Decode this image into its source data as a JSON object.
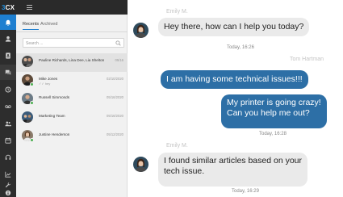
{
  "app": {
    "logo_number": "3",
    "logo_text": "CX"
  },
  "colors": {
    "accent": "#1e7fd0",
    "outgoing_bubble": "#2d6fa6",
    "incoming_bubble": "#eaeaea",
    "rail_bg": "#2d2d2d",
    "online": "#4caf50"
  },
  "rail": {
    "items": [
      {
        "icon": "bell-icon",
        "active": true
      },
      {
        "icon": "user-icon",
        "active": false
      },
      {
        "icon": "contacts-icon",
        "active": false
      },
      {
        "icon": "chat-icon",
        "active": false
      },
      {
        "icon": "history-icon",
        "active": false
      },
      {
        "icon": "voicemail-icon",
        "active": false
      },
      {
        "icon": "people-icon",
        "active": false
      },
      {
        "icon": "calendar-icon",
        "active": false
      },
      {
        "icon": "headset-icon",
        "active": false
      },
      {
        "icon": "stats-icon",
        "active": false
      },
      {
        "icon": "wrench-icon",
        "active": false
      },
      {
        "icon": "info-icon",
        "active": false
      }
    ]
  },
  "panel": {
    "tabs": [
      {
        "label": "Recents"
      },
      {
        "label": "Archived"
      }
    ],
    "search_placeholder": "Search ...",
    "conversations": [
      {
        "name": "Pauline Richards, Lina Dee, Lia Shelton",
        "date": "05/16",
        "sub": ""
      },
      {
        "name": "Mike Jones",
        "date": "02/10/2020",
        "sub": "✓✓ hey"
      },
      {
        "name": "Russell Simmonds",
        "date": "05/16/2020",
        "sub": ""
      },
      {
        "name": "Marketing Team",
        "date": "05/16/2020",
        "sub": ""
      },
      {
        "name": "Justine Henderson",
        "date": "05/12/2020",
        "sub": ""
      }
    ]
  },
  "chat": {
    "messages": [
      {
        "sender": "Emily M.",
        "text": "Hey there, how can I help you today?",
        "time": "Today, 16:26"
      },
      {
        "sender": "Tom Hartman",
        "text": "I am having some technical issues!!!"
      },
      {
        "text_line1": "My printer is going crazy!",
        "text_line2": "Can you help me out?",
        "time": "Today, 16:28"
      },
      {
        "sender": "Emily M.",
        "text_line1": "I found similar articles based on your",
        "text_line2": "tech issue.",
        "time": "Today, 16:29"
      }
    ]
  }
}
